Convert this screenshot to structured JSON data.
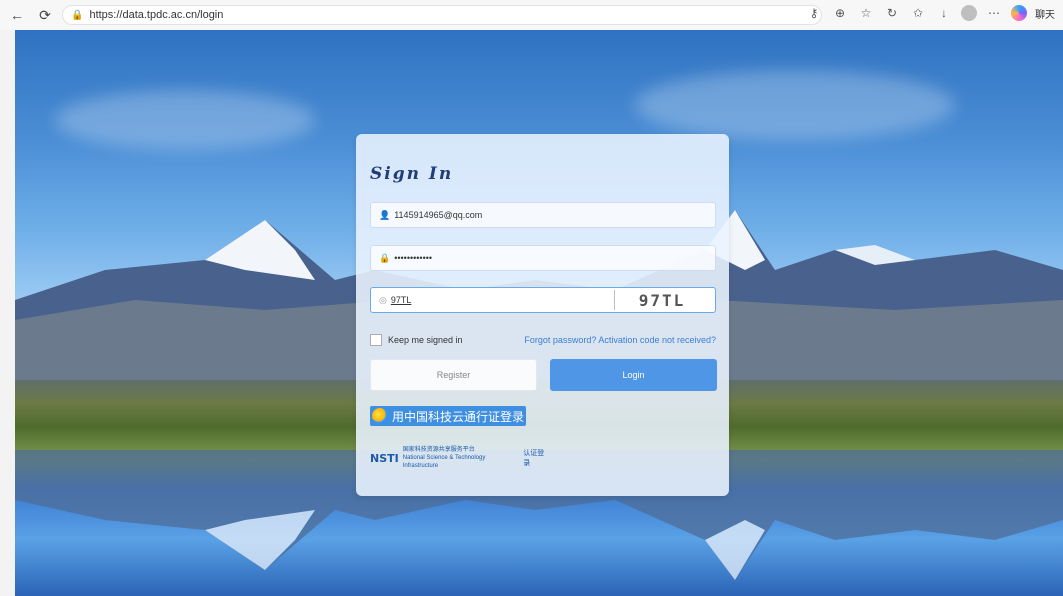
{
  "browser": {
    "url": "https://data.tpdc.ac.cn/login",
    "back_icon": "back-arrow-icon",
    "refresh_icon": "refresh-icon",
    "extra_label": "聊天"
  },
  "login": {
    "title": "Sign In",
    "email_value": "1145914965@qq.com",
    "password_value": "••••••••••••",
    "captcha_value": "97TL",
    "captcha_image_text": "97TL",
    "remember_label": "Keep me signed in",
    "forgot_label": "Forgot password? Activation code not received?",
    "register_label": "Register",
    "login_label": "Login",
    "cstcloud_label": "用中国科技云通行证登录",
    "nsti_logo_text": "NSTI",
    "nsti_name": "国家科技资源共享服务平台",
    "nsti_sub": "National Science & Technology Infrastructure",
    "nsti_cert": "认证登录"
  },
  "colors": {
    "accent": "#4f96e6",
    "title": "#223c77",
    "link": "#3b7ed1"
  }
}
